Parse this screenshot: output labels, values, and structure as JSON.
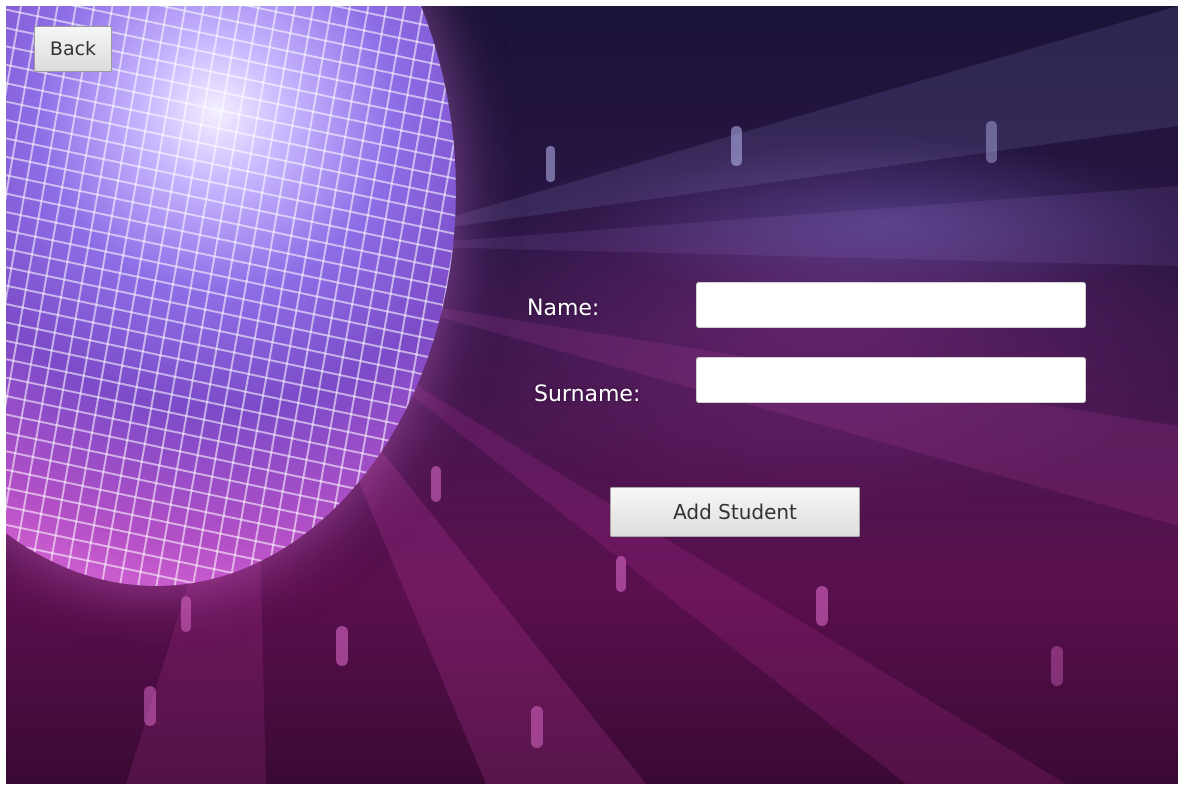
{
  "toolbar": {
    "back_label": "Back"
  },
  "form": {
    "name": {
      "label": "Name:",
      "value": "",
      "placeholder": ""
    },
    "surname": {
      "label": "Surname:",
      "value": "",
      "placeholder": ""
    },
    "submit_label": "Add Student"
  },
  "background": {
    "image": "disco-ball",
    "colors": {
      "top": "#1b1338",
      "middle": "#4a1650",
      "bottom": "#5a0f4e",
      "ball_highlight": "#f4efff",
      "ball_edge": "#e06ad6"
    }
  }
}
